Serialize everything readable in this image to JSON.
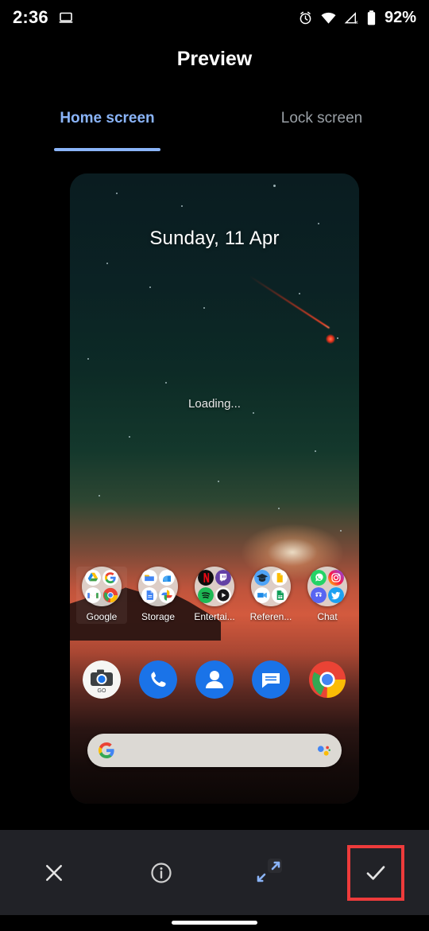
{
  "status_bar": {
    "time": "2:36",
    "battery_text": "92%",
    "icons": [
      "laptop-cast-icon",
      "alarm-icon",
      "wifi-icon",
      "cellular-no-signal-icon",
      "battery-icon"
    ]
  },
  "header": {
    "title": "Preview"
  },
  "tabs": [
    {
      "label": "Home screen",
      "selected": true
    },
    {
      "label": "Lock screen",
      "selected": false
    }
  ],
  "preview": {
    "date": "Sunday, 11 Apr",
    "loading": "Loading...",
    "wallpaper_description": "night-sky-sunset-meteor",
    "folders": [
      {
        "label": "Google",
        "highlighted": true,
        "apps": [
          "drive",
          "google",
          "gmail",
          "chrome"
        ]
      },
      {
        "label": "Storage",
        "highlighted": false,
        "apps": [
          "files",
          "drive",
          "docs",
          "photos"
        ]
      },
      {
        "label": "Entertai...",
        "highlighted": false,
        "apps": [
          "netflix",
          "twitch",
          "spotify",
          "youtube"
        ]
      },
      {
        "label": "Referen...",
        "highlighted": false,
        "apps": [
          "classroom",
          "keep",
          "meet",
          "sheets"
        ]
      },
      {
        "label": "Chat",
        "highlighted": false,
        "apps": [
          "whatsapp",
          "instagram",
          "discord",
          "twitter"
        ]
      }
    ],
    "dock": [
      {
        "name": "camera-go-icon"
      },
      {
        "name": "phone-icon"
      },
      {
        "name": "contacts-icon"
      },
      {
        "name": "messages-icon"
      },
      {
        "name": "chrome-icon"
      }
    ],
    "search_bar": {
      "left_icon": "google-g-icon",
      "right_icon": "google-assistant-icon",
      "text": ""
    }
  },
  "toolbar": {
    "buttons": [
      {
        "name": "close-button",
        "icon": "close-icon",
        "highlighted": false
      },
      {
        "name": "info-button",
        "icon": "info-icon",
        "highlighted": false
      },
      {
        "name": "expand-button",
        "icon": "expand-icon",
        "highlighted": false
      },
      {
        "name": "apply-button",
        "icon": "check-icon",
        "highlighted": true
      }
    ],
    "highlight_color": "#ee3b3b"
  },
  "theme": {
    "accent": "#8ab4f8",
    "background": "#000000",
    "toolbar_background": "#212227",
    "inactive_text": "#9aa0a6"
  }
}
